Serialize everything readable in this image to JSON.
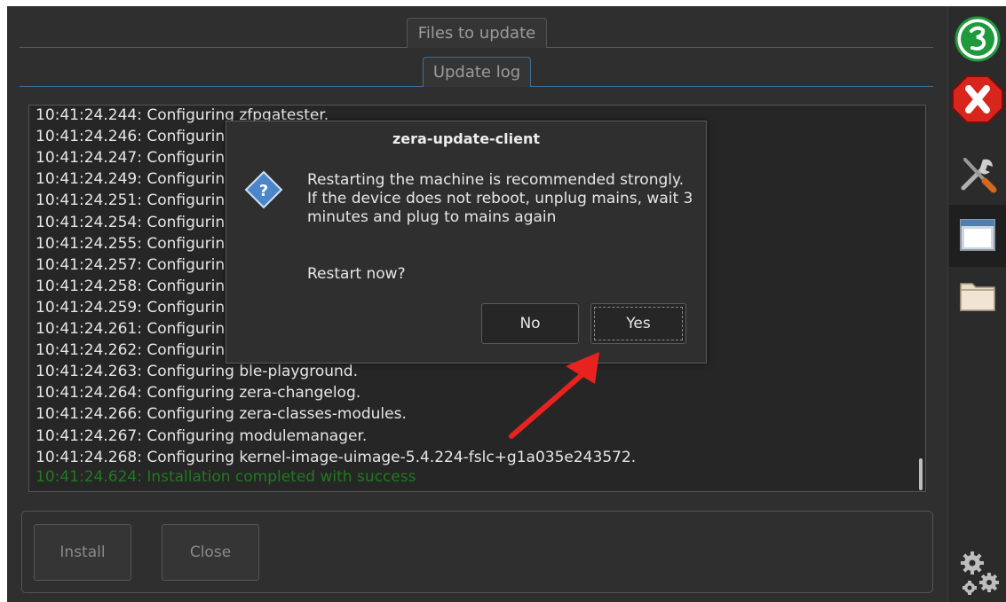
{
  "tabs": {
    "files_to_update": "Files to update",
    "update_log": "Update log"
  },
  "log": {
    "lines": [
      "10:41:24.244: Configuring zfpgatester.",
      "10:41:24.246: Configuring",
      "10:41:24.247: Configuring",
      "10:41:24.249: Configuring",
      "10:41:24.251: Configuring",
      "10:41:24.254: Configuring",
      "10:41:24.255: Configuring",
      "10:41:24.257: Configuring",
      "10:41:24.258: Configuring",
      "10:41:24.259: Configuring",
      "10:41:24.261: Configuring",
      "10:41:24.262: Configuring",
      "10:41:24.263: Configuring ble-playground.",
      "10:41:24.264: Configuring zera-changelog.",
      "10:41:24.266: Configuring zera-classes-modules.",
      "10:41:24.267: Configuring modulemanager.",
      "10:41:24.268: Configuring kernel-image-uimage-5.4.224-fslc+g1a035e243572."
    ],
    "success_line": "10:41:24.624: Installation completed with success",
    "success_color": "#1f7a1f"
  },
  "buttons": {
    "install": "Install",
    "close": "Close"
  },
  "dialog": {
    "title": "zera-update-client",
    "message": "Restarting the machine is recommended strongly. If the device does not reboot, unplug mains, wait 3 minutes and plug to mains again",
    "question": "Restart now?",
    "no": "No",
    "yes": "Yes"
  },
  "sidebar": {
    "icons": [
      "zera-logo-icon",
      "close-icon",
      "tools-icon",
      "window-icon",
      "folder-icon",
      "settings-gears-icon"
    ]
  },
  "colors": {
    "accent": "#3d6f9e",
    "annotation_arrow": "#e8231f",
    "close_red": "#d9261c",
    "logo_green": "#1e9a3c"
  }
}
